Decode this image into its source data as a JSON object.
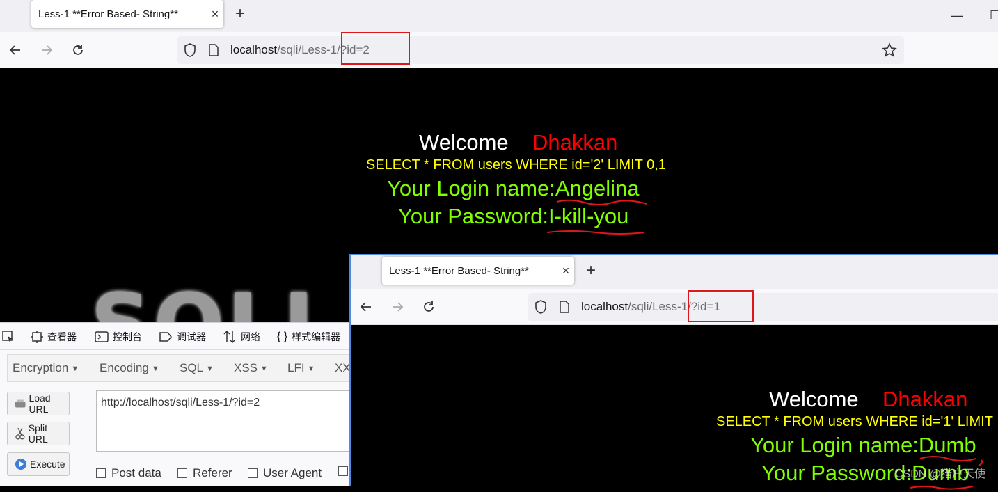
{
  "browser_back": {
    "tab_title": "Less-1 **Error Based- String**",
    "tab_close": "×",
    "new_tab": "+",
    "url_host": "localhost",
    "url_path": "/sqli/Less-1/?id=2",
    "window_minimize": "—",
    "window_maximize": "☐"
  },
  "page_back": {
    "welcome": "Welcome",
    "name": "Dhakkan",
    "query": "SELECT * FROM users WHERE id='2' LIMIT 0,1",
    "login_name": "Your Login name:Angelina",
    "password": "Your Password:I-kill-you",
    "logo_text": "SQLI"
  },
  "devtools": {
    "tabs": [
      {
        "label": "查看器",
        "icon": "inspector-icon"
      },
      {
        "label": "控制台",
        "icon": "console-icon"
      },
      {
        "label": "调试器",
        "icon": "debugger-icon"
      },
      {
        "label": "网络",
        "icon": "network-icon"
      },
      {
        "label": "样式编辑器",
        "icon": "style-editor-icon"
      }
    ]
  },
  "hackbar": {
    "menu": [
      {
        "label": "Encryption"
      },
      {
        "label": "Encoding"
      },
      {
        "label": "SQL"
      },
      {
        "label": "XSS"
      },
      {
        "label": "LFI"
      },
      {
        "label": "XX"
      }
    ],
    "buttons": [
      {
        "label": "Load URL",
        "icon": "load-url-icon"
      },
      {
        "label": "Split URL",
        "icon": "scissors-icon"
      },
      {
        "label": "Execute",
        "icon": "play-icon"
      }
    ],
    "url_value": "http://localhost/sqli/Less-1/?id=2",
    "checkboxes": [
      {
        "label": "Post data",
        "checked": false
      },
      {
        "label": "Referer",
        "checked": false
      },
      {
        "label": "User Agent",
        "checked": false
      }
    ]
  },
  "browser_front": {
    "tab_title": "Less-1 **Error Based- String**",
    "tab_close": "×",
    "new_tab": "+",
    "url_host": "localhost",
    "url_path": "/sqli/Less-1/?id=1"
  },
  "page_front": {
    "welcome": "Welcome",
    "name": "Dhakkan",
    "query": "SELECT * FROM users WHERE id='1' LIMIT",
    "login_name": "Your Login name:Dumb",
    "password": "Your Password:Dumb"
  },
  "watermark": "CSDN @猎户天使",
  "colors": {
    "welcome": "#ffffff",
    "name": "#ff0000",
    "query": "#ffff00",
    "credentials": "#80ff00",
    "highlight_box": "#e0161b",
    "annotation_underline": "#e0161b"
  }
}
